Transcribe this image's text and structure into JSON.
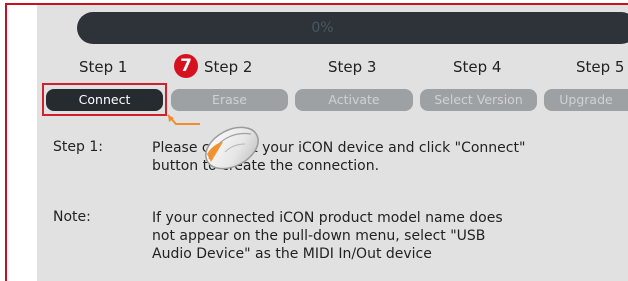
{
  "progress": {
    "text": "0%",
    "value": 0
  },
  "steps": [
    {
      "label": "Step 1",
      "button": "Connect"
    },
    {
      "label": "Step 2",
      "button": "Erase"
    },
    {
      "label": "Step 3",
      "button": "Activate"
    },
    {
      "label": "Step 4",
      "button": "Select Version"
    },
    {
      "label": "Step 5",
      "button": "Upgrade"
    }
  ],
  "annotation": {
    "badge": "7"
  },
  "info": {
    "step1_label": "Step 1:",
    "step1_text": "Please connect your iCON device and click \"Connect\"\nbutton to create the connection.",
    "note_label": "Note:",
    "note_text": "If your connected iCON product model name does\nnot appear on the pull-down menu, select \"USB\nAudio Device\" as the MIDI In/Out device"
  },
  "colors": {
    "frame": "#c8101e",
    "panel": "#e1e1e1",
    "button_active": "#262b30",
    "button_disabled": "#9ea1a3",
    "badge": "#d7101f"
  },
  "icons": {
    "pointer": "mouse-icon",
    "callout": "arrow-line-icon"
  }
}
